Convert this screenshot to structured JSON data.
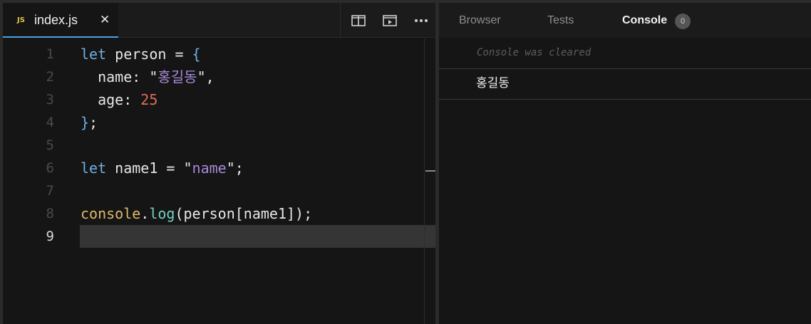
{
  "editor": {
    "tab": {
      "icon_label": "JS",
      "filename": "index.js",
      "close_glyph": "✕"
    },
    "toolbar": {
      "icons": [
        "split-editor-icon",
        "preview-icon",
        "more-actions-icon"
      ]
    },
    "line_numbers": [
      "1",
      "2",
      "3",
      "4",
      "5",
      "6",
      "7",
      "8",
      "9"
    ],
    "active_line": "9",
    "code": [
      [
        {
          "t": "let",
          "k": "kw"
        },
        {
          "t": " person = ",
          "k": "plain"
        },
        {
          "t": "{",
          "k": "brace"
        }
      ],
      [
        {
          "t": "  name: ",
          "k": "plain"
        },
        {
          "t": "\"",
          "k": "plain"
        },
        {
          "t": "홍길동",
          "k": "str"
        },
        {
          "t": "\",",
          "k": "plain"
        }
      ],
      [
        {
          "t": "  age: ",
          "k": "plain"
        },
        {
          "t": "25",
          "k": "num"
        }
      ],
      [
        {
          "t": "}",
          "k": "brace"
        },
        {
          "t": ";",
          "k": "plain"
        }
      ],
      [],
      [
        {
          "t": "let",
          "k": "kw"
        },
        {
          "t": " name1 = ",
          "k": "plain"
        },
        {
          "t": "\"",
          "k": "plain"
        },
        {
          "t": "name",
          "k": "str"
        },
        {
          "t": "\";",
          "k": "plain"
        }
      ],
      [],
      [
        {
          "t": "console",
          "k": "obj"
        },
        {
          "t": ".",
          "k": "plain"
        },
        {
          "t": "log",
          "k": "fn"
        },
        {
          "t": "(person[name1]);",
          "k": "plain"
        }
      ],
      []
    ]
  },
  "preview": {
    "tabs": [
      {
        "label": "Browser",
        "active": false
      },
      {
        "label": "Tests",
        "active": false
      },
      {
        "label": "Console",
        "active": true
      }
    ],
    "console_badge": "0",
    "cleared_message": "Console was cleared",
    "log_output": "홍길동"
  },
  "colors": {
    "background": "#151515",
    "tab_accent": "#4aa3df",
    "keyword": "#6fb0e6",
    "string": "#a88ad8",
    "number": "#e06c5a",
    "object": "#e0b86a",
    "function": "#6fd0c0"
  }
}
